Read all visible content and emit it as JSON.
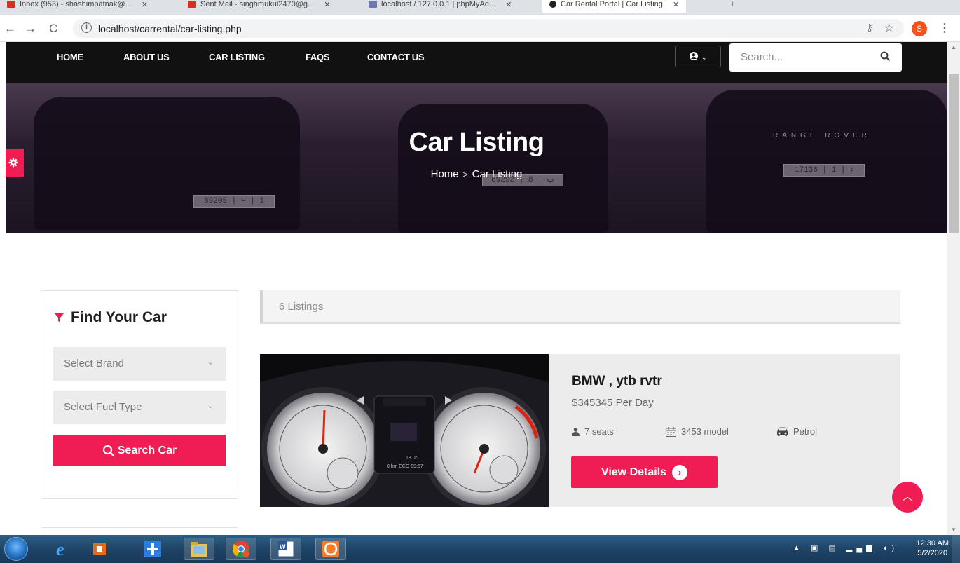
{
  "browser": {
    "tabs": [
      {
        "label": "Inbox (953) - shashimpatnak@..."
      },
      {
        "label": "Sent Mail - singhmukul2470@g..."
      },
      {
        "label": "localhost / 127.0.0.1 | phpMyAd..."
      },
      {
        "label": "Car Rental Portal | Car Listing"
      }
    ],
    "url": "localhost/carrental/car-listing.php",
    "profile_initial": "S"
  },
  "nav": {
    "links": [
      "HOME",
      "ABOUT US",
      "CAR LISTING",
      "FAQS",
      "CONTACT US"
    ],
    "search_placeholder": "Search..."
  },
  "hero": {
    "title": "Car Listing",
    "breadcrumb_home": "Home",
    "breadcrumb_current": "Car Listing",
    "plates": [
      "89205 | ~ | 1",
      "89292 | ب | 8",
      "17136 | ء | 1"
    ],
    "badge_text": "RANGE ROVER"
  },
  "sidebar": {
    "title": "Find Your Car",
    "brand_placeholder": "Select Brand",
    "fuel_placeholder": "Select Fuel Type",
    "search_button": "Search Car"
  },
  "listing": {
    "count_text": "6 Listings",
    "cards": [
      {
        "title": "BMW , ytb rvtr",
        "price": "$345345 Per Day",
        "seats": "7 seats",
        "model": "3453 model",
        "fuel": "Petrol",
        "button": "View Details"
      }
    ]
  },
  "taskbar": {
    "time": "12:30 AM",
    "date": "5/2/2020"
  },
  "colors": {
    "accent": "#f01d55",
    "nav_bg": "#111111",
    "card_bg": "#ececec"
  }
}
